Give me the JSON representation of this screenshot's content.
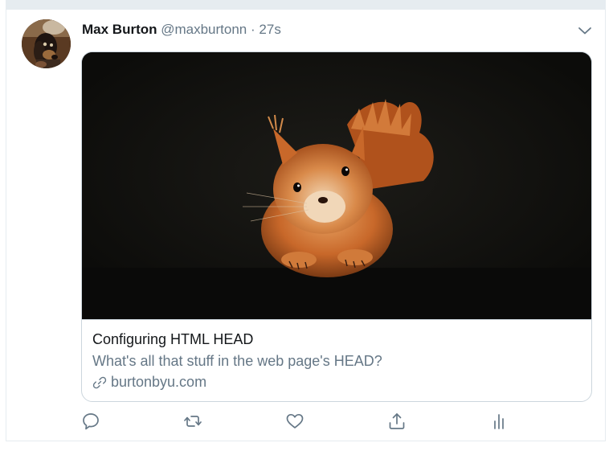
{
  "tweet": {
    "author_name": "Max Burton",
    "author_handle": "@maxburtonn",
    "separator": "·",
    "timestamp": "27s",
    "avatar_icon": "dachshund-avatar",
    "menu_icon": "chevron-down-icon"
  },
  "card": {
    "image_subject": "red squirrel photo",
    "title": "Configuring HTML HEAD",
    "description": "What's all that stuff in the web page's HEAD?",
    "domain": "burtonbyu.com",
    "link_icon": "link-icon"
  },
  "actions": {
    "reply_icon": "reply-icon",
    "retweet_icon": "retweet-icon",
    "like_icon": "heart-icon",
    "share_icon": "share-icon",
    "analytics_icon": "analytics-icon"
  },
  "colors": {
    "text_primary": "#14171a",
    "text_secondary": "#657786",
    "border": "#ccd6dd",
    "divider": "#e6ecf0",
    "icon": "#657786"
  }
}
